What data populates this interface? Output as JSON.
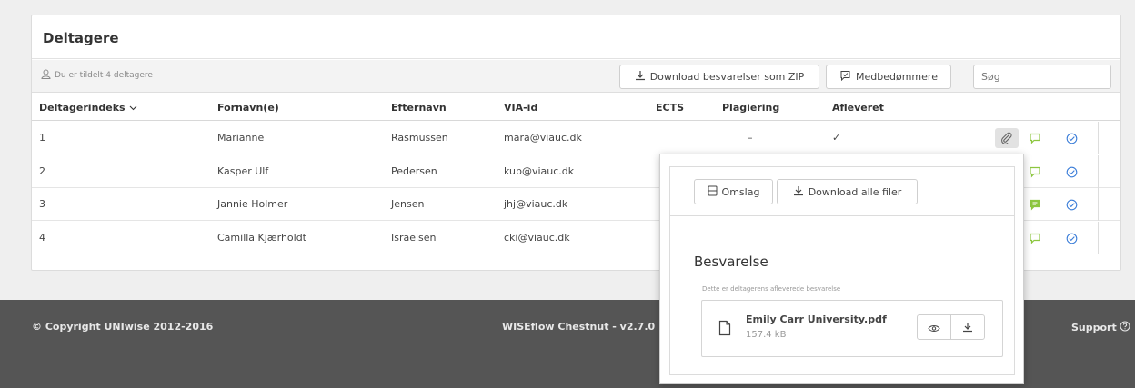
{
  "panel": {
    "title": "Deltagere"
  },
  "toolbar": {
    "assigned_text": "Du er tildelt 4 deltagere",
    "download_zip_label": "Download besvarelser som ZIP",
    "coassessors_label": "Medbedømmere",
    "search_placeholder": "Søg"
  },
  "table": {
    "headers": {
      "index": "Deltagerindeks",
      "firstname": "Fornavn(e)",
      "lastname": "Efternavn",
      "via_id": "VIA-id",
      "ects": "ECTS",
      "plagiarism": "Plagiering",
      "submitted": "Afleveret"
    },
    "rows": [
      {
        "index": "1",
        "firstname": "Marianne",
        "lastname": "Rasmussen",
        "via_id": "mara@viauc.dk",
        "plagiarism": "–",
        "submitted": "✓"
      },
      {
        "index": "2",
        "firstname": "Kasper Ulf",
        "lastname": "Pedersen",
        "via_id": "kup@viauc.dk"
      },
      {
        "index": "3",
        "firstname": "Jannie Holmer",
        "lastname": "Jensen",
        "via_id": "jhj@viauc.dk"
      },
      {
        "index": "4",
        "firstname": "Camilla Kjærholdt",
        "lastname": "Israelsen",
        "via_id": "cki@viauc.dk"
      }
    ]
  },
  "footer": {
    "copyright": "© Copyright UNIwise 2012-2016",
    "version": "WISEflow Chestnut - v2.7.0",
    "support": "Support"
  },
  "popover": {
    "cover_label": "Omslag",
    "download_all_label": "Download alle filer",
    "heading": "Besvarelse",
    "subtext": "Dette er deltagerens afleverede besvarelse",
    "file_name": "Emily Carr University.pdf",
    "file_size": "157.4 kB"
  },
  "colors": {
    "accent_blue": "#3b7dd8",
    "comment_green": "#8cc63f",
    "footer_bg": "#555555"
  }
}
